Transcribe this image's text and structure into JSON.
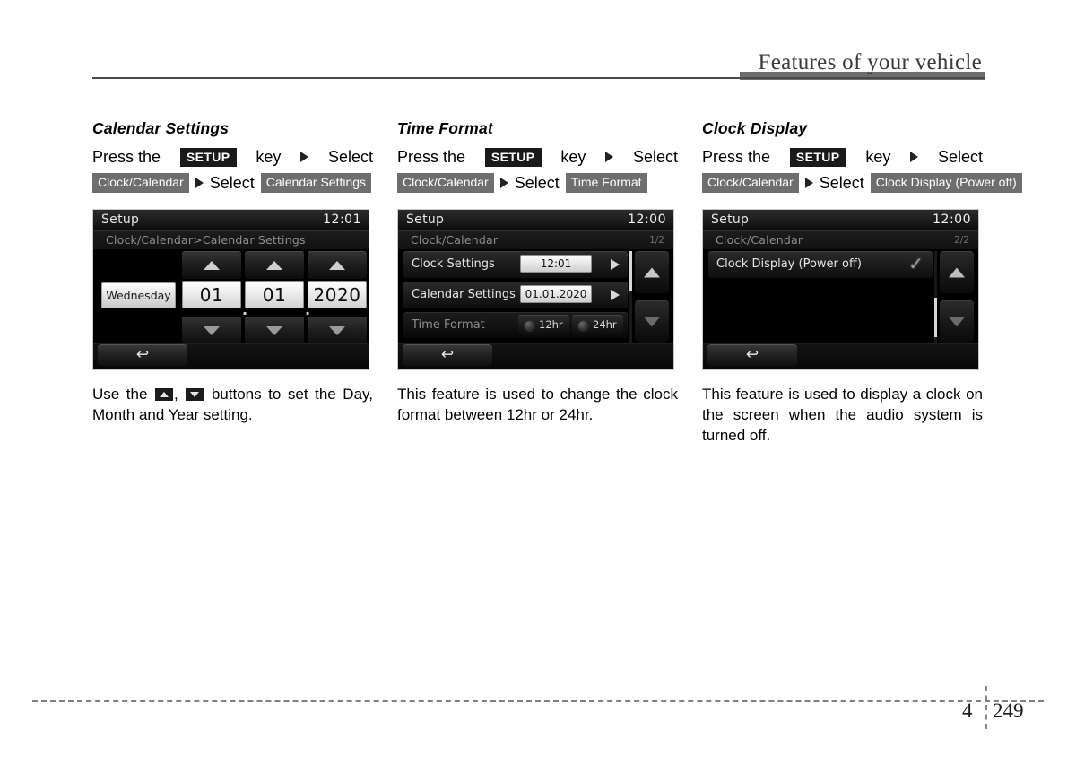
{
  "header": {
    "title": "Features of your vehicle"
  },
  "footer": {
    "chapter": "4",
    "page": "249"
  },
  "common": {
    "press_the": "Press  the",
    "setup_key_label": "SETUP",
    "key_word": "key",
    "select_word": "Select",
    "clock_calendar_chip": "Clock/Calendar",
    "arrow_icon": "right-triangle"
  },
  "columns": [
    {
      "title": "Calendar Settings",
      "instruction": {
        "press": "Press  the",
        "setup": "SETUP",
        "key": "key",
        "select1": "Select",
        "chip1": "Clock/Calendar",
        "select2": "Select",
        "chip2": "Calendar Settings"
      },
      "screen": {
        "title": "Setup",
        "clock": "12:01",
        "breadcrumb": "Clock/Calendar>Calendar Settings",
        "weekday": "Wednesday",
        "day": "01",
        "month": "01",
        "year": "2020",
        "separator": ".",
        "up_icon": "triangle-up-icon",
        "down_icon": "triangle-down-icon",
        "back_icon": "back-arrow-icon"
      },
      "caption_parts": {
        "p1": "Use  the",
        "p2": ",",
        "p3": "buttons  to  set  the Day, Month and Year setting."
      }
    },
    {
      "title": "Time Format",
      "instruction": {
        "press": "Press  the",
        "setup": "SETUP",
        "key": "key",
        "select1": "Select",
        "chip1": "Clock/Calendar",
        "select2": "Select",
        "chip2": "Time Format"
      },
      "screen": {
        "title": "Setup",
        "clock": "12:00",
        "breadcrumb": "Clock/Calendar",
        "page_indicator": "1/2",
        "rows": [
          {
            "label": "Clock Settings",
            "value": "12:01",
            "chevron": "chevron-right-icon"
          },
          {
            "label": "Calendar Settings",
            "value": "01.01.2020",
            "chevron": "chevron-right-icon"
          }
        ],
        "time_format_label": "Time Format",
        "time_format_options": [
          "12hr",
          "24hr"
        ],
        "back_icon": "back-arrow-icon"
      },
      "caption": "This  feature  is  used  to  change  the clock format between 12hr or 24hr."
    },
    {
      "title": "Clock Display",
      "instruction": {
        "press": "Press  the",
        "setup": "SETUP",
        "key": "key",
        "select1": "Select",
        "chip1": "Clock/Calendar",
        "select2": "Select",
        "chip2": "Clock Display (Power off)"
      },
      "screen": {
        "title": "Setup",
        "clock": "12:00",
        "breadcrumb": "Clock/Calendar",
        "page_indicator": "2/2",
        "toggle_label": "Clock Display (Power off)",
        "toggle_checked": "✓",
        "back_icon": "back-arrow-icon"
      },
      "caption": "This feature is used to display a clock on  the  screen  when  the  audio  system is turned off."
    }
  ],
  "colors": {
    "screen_bg": "#000000",
    "chip_gray": "#6e6e6e",
    "chip_dark": "#1a1a1a",
    "header_rule": "#4a4a4a",
    "header_block": "#6d6d6d",
    "check_green": "#8fa08a"
  }
}
